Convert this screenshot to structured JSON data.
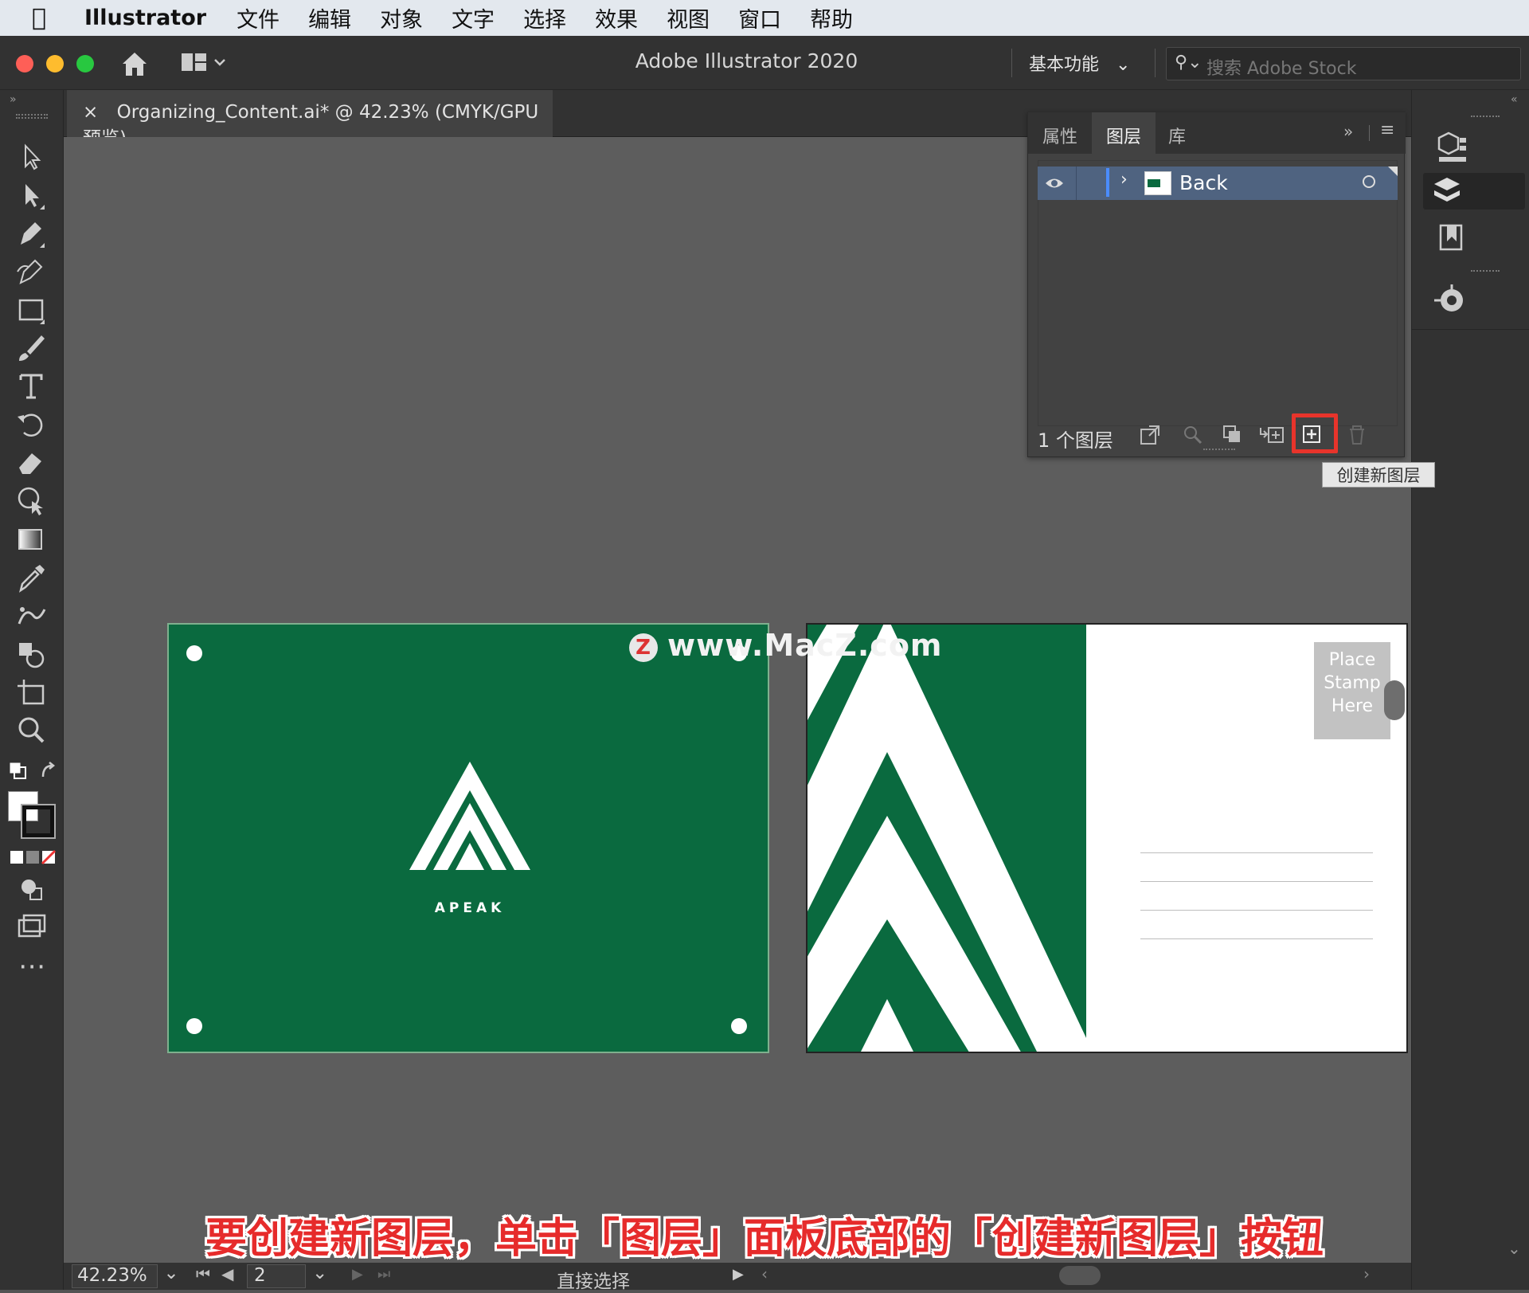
{
  "menubar": {
    "app_name": "Illustrator",
    "items": [
      "文件",
      "编辑",
      "对象",
      "文字",
      "选择",
      "效果",
      "视图",
      "窗口",
      "帮助"
    ]
  },
  "appbar": {
    "title": "Adobe Illustrator 2020",
    "workspace": "基本功能",
    "search_placeholder": "搜索 Adobe Stock"
  },
  "document": {
    "tab_title": "Organizing_Content.ai* @ 42.23% (CMYK/GPU 预览)",
    "close_glyph": "×"
  },
  "artboard1": {
    "logo_text": "APEAK",
    "color": "#0a6a3f"
  },
  "artboard2": {
    "stamp_lines": [
      "Place",
      "Stamp",
      "Here"
    ]
  },
  "watermark": {
    "text": "www.MacZ.com",
    "badge": "Z"
  },
  "layers_panel": {
    "tabs": [
      "属性",
      "图层",
      "库"
    ],
    "active_tab": "图层",
    "layers": [
      {
        "name": "Back"
      }
    ],
    "count_label": "1 个图层",
    "tooltip": "创建新图层"
  },
  "status": {
    "zoom": "42.23%",
    "artboard_number": "2",
    "tool_name": "直接选择"
  },
  "caption": "要创建新图层，单击「图层」面板底部的「创建新图层」按钮",
  "colors": {
    "accent_highlight": "#e8342b",
    "layer_selected": "#4f6380",
    "brand_green": "#0a6a3f"
  }
}
